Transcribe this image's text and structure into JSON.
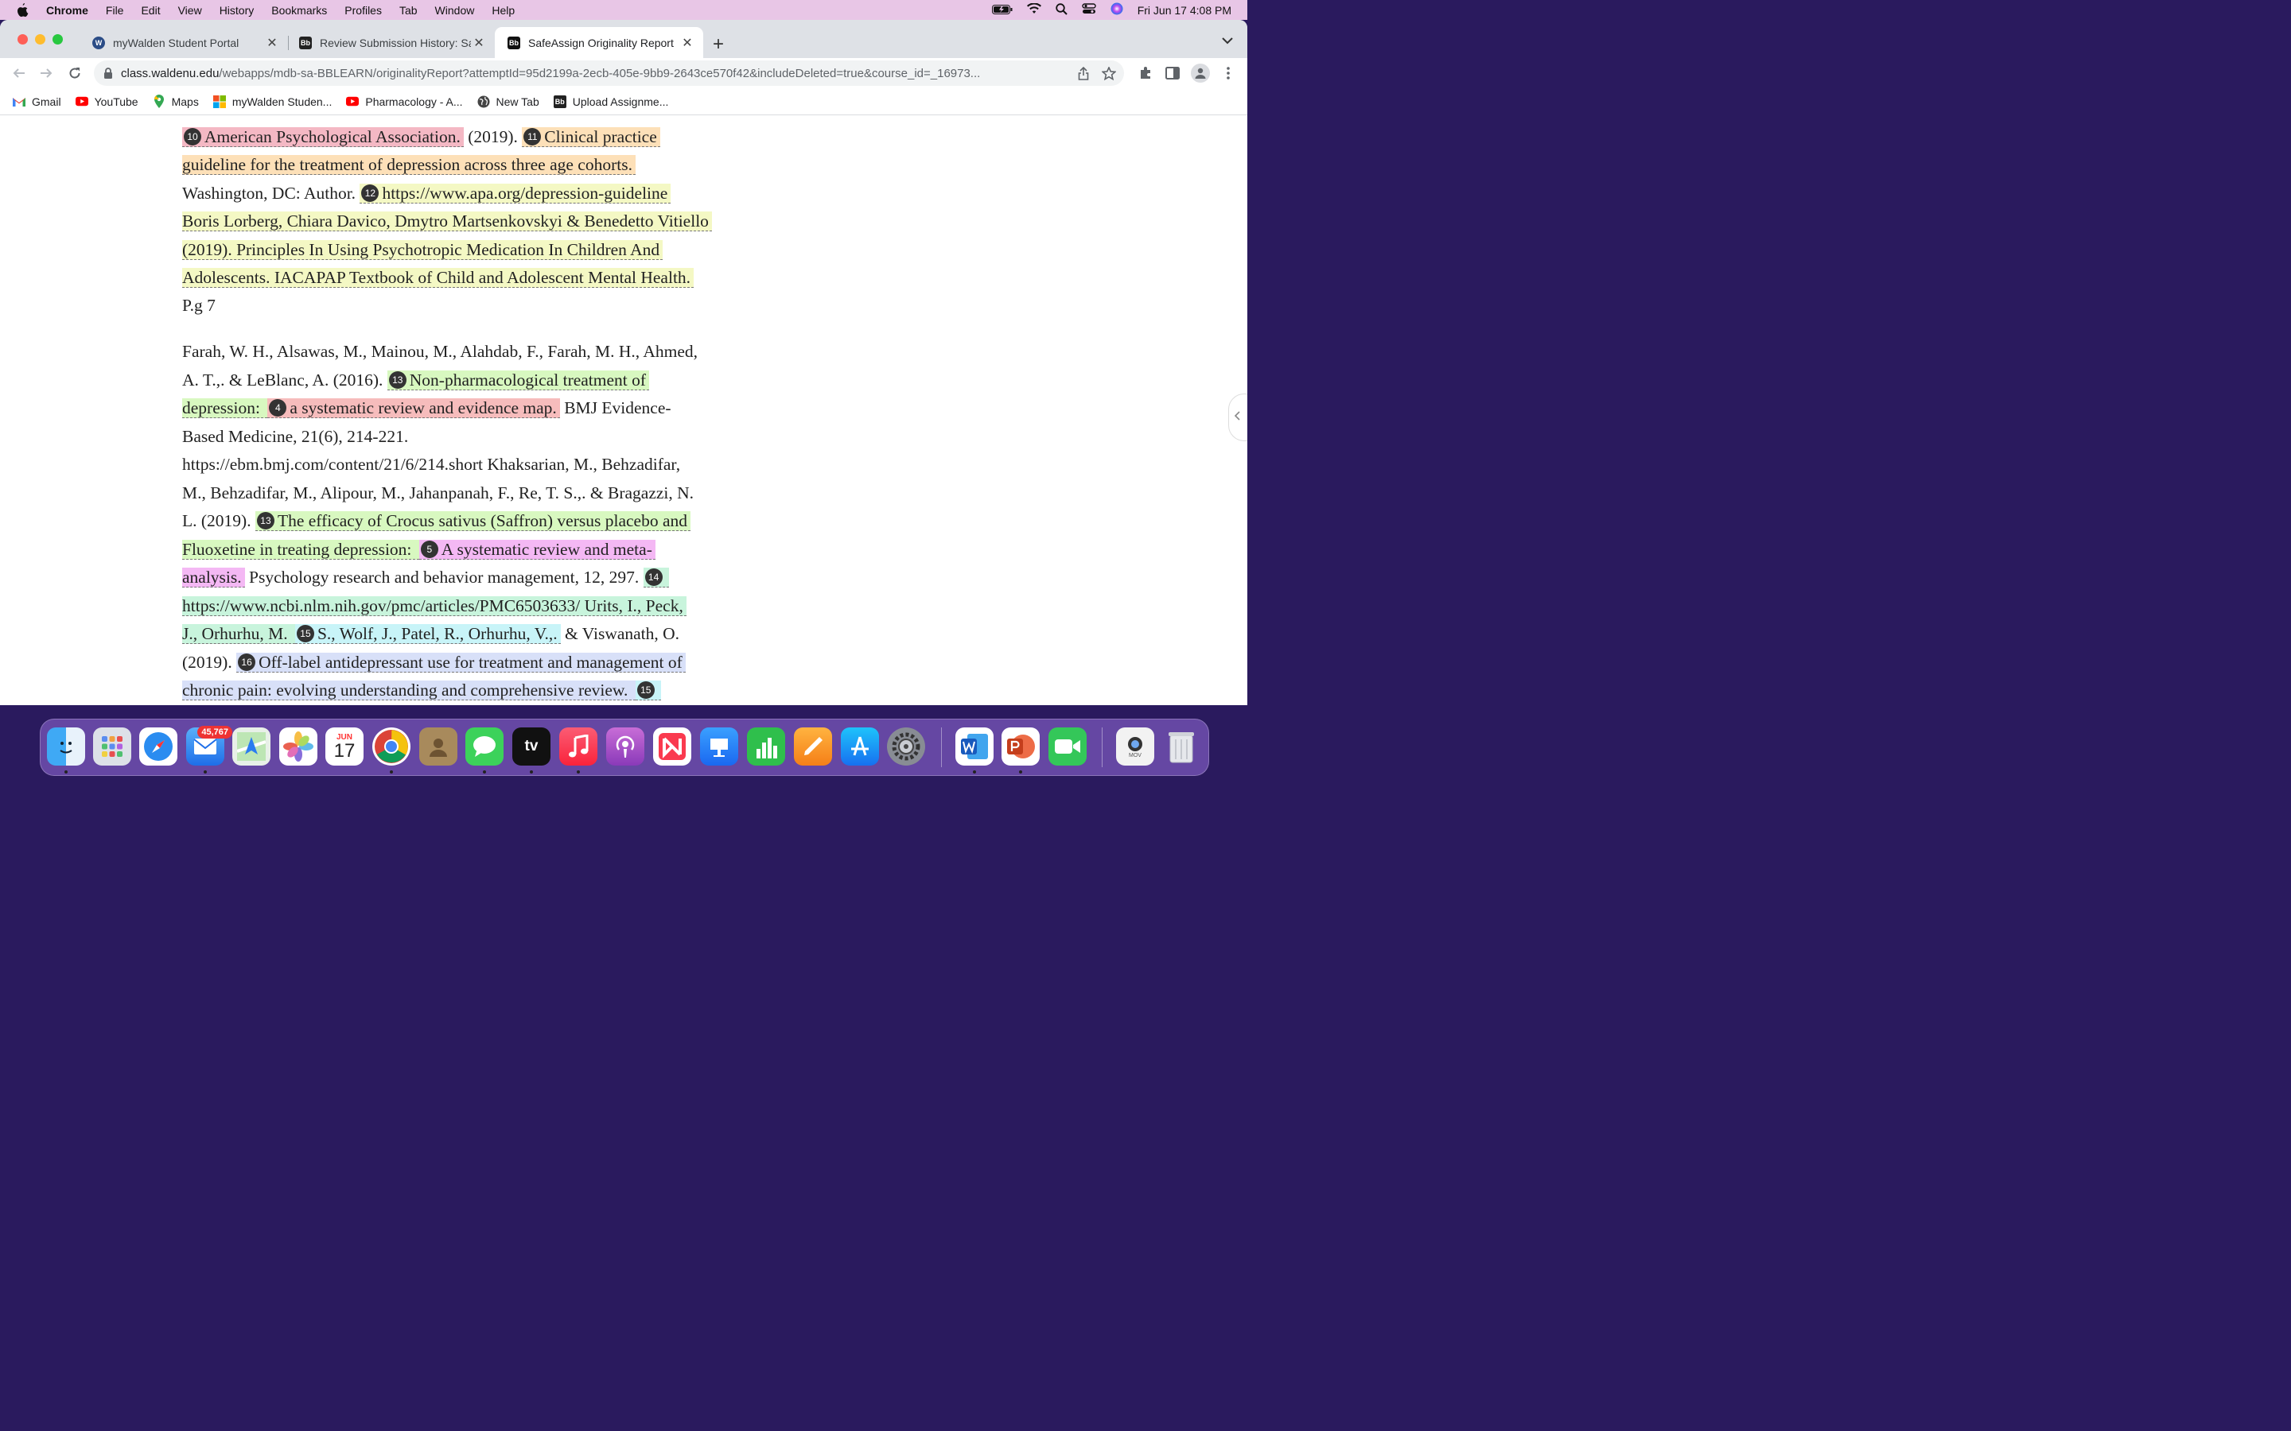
{
  "menubar": {
    "app": "Chrome",
    "items": [
      "File",
      "Edit",
      "View",
      "History",
      "Bookmarks",
      "Profiles",
      "Tab",
      "Window",
      "Help"
    ],
    "clock": "Fri Jun 17  4:08 PM"
  },
  "tabs": [
    {
      "label": "myWalden Student Portal",
      "icon": "wordpress-icon"
    },
    {
      "label": "Review Submission History: Sa",
      "icon": "blackboard-icon"
    },
    {
      "label": "SafeAssign Originality Report",
      "icon": "blackboard-icon"
    }
  ],
  "favicon_text": "Bb",
  "address": {
    "host": "class.waldenu.edu",
    "path": "/webapps/mdb-sa-BBLEARN/originalityReport?attemptId=95d2199a-2ecb-405e-9bb9-2643ce570f42&includeDeleted=true&course_id=_16973..."
  },
  "bookmarks": [
    {
      "label": "Gmail",
      "icon": "gmail-icon"
    },
    {
      "label": "YouTube",
      "icon": "youtube-icon"
    },
    {
      "label": "Maps",
      "icon": "maps-icon"
    },
    {
      "label": "myWalden Studen...",
      "icon": "microsoft-icon"
    },
    {
      "label": "Pharmacology - A...",
      "icon": "youtube-icon"
    },
    {
      "label": "New Tab",
      "icon": "globe-icon"
    },
    {
      "label": "Upload Assignme...",
      "icon": "blackboard-icon"
    }
  ],
  "report": {
    "l1": {
      "a": "American Psychological Association.",
      "b": " (2019). ",
      "c": "Clinical practice",
      "badge1": "10",
      "badge2": "11"
    },
    "l2": {
      "a": "guideline for the treatment of depression across three age cohorts."
    },
    "l3": {
      "a": "Washington, DC: Author. ",
      "badge": "12",
      "b": "https://www.apa.org/depression-guideline"
    },
    "l4": {
      "a": "Boris Lorberg, Chiara Davico, Dmytro Martsenkovskyi & Benedetto Vitiello"
    },
    "l5": {
      "a": "(2019).  Principles In Using Psychotropic Medication In Children And"
    },
    "l6": {
      "a": "Adolescents.  IACAPAP Textbook of Child and Adolescent Mental Health."
    },
    "l7": {
      "a": "P.g 7"
    },
    "l8": {
      "a": "Farah, W. H., Alsawas, M., Mainou, M., Alahdab, F., Farah, M. H., Ahmed,"
    },
    "l9": {
      "a": "A. T.,. & LeBlanc, A. (2016). ",
      "badge": "13",
      "b": "Non-pharmacological treatment of"
    },
    "l10": {
      "a": "depression: ",
      "badge": "4",
      "b": "a systematic review and evidence map.",
      "c": " BMJ Evidence-"
    },
    "l11": {
      "a": "Based Medicine, 21(6), 214-221."
    },
    "l12": {
      "a": "https://ebm.bmj.com/content/21/6/214.short Khaksarian, M., Behzadifar,"
    },
    "l13": {
      "a": "M., Behzadifar, M., Alipour, M., Jahanpanah, F., Re, T. S.,. & Bragazzi, N."
    },
    "l14": {
      "a": "L. (2019). ",
      "badge": "13",
      "b": "The efficacy of Crocus sativus (Saffron) versus placebo and"
    },
    "l15": {
      "a": "Fluoxetine in treating depression: ",
      "badge": "5",
      "b": "A systematic review and meta-"
    },
    "l16": {
      "a": "analysis.",
      "b": " Psychology research and behavior management, 12, 297. ",
      "badge": "14"
    },
    "l17": {
      "a": "https://www.ncbi.nlm.nih.gov/pmc/articles/PMC6503633/ Urits, I., Peck,"
    },
    "l18": {
      "a": "J., Orhurhu, M. ",
      "badge": "15",
      "b": "S., Wolf, J., Patel, R., Orhurhu, V.,.",
      "c": " & Viswanath, O."
    },
    "l19": {
      "a": "(2019). ",
      "badge": "16",
      "b": "Off-label antidepressant use for treatment and management of"
    },
    "l20": {
      "a": "chronic pain:  evolving understanding and comprehensive review. ",
      "badge": "15"
    }
  },
  "dock": {
    "mail_badge": "45,767",
    "calendar_month": "JUN",
    "calendar_day": "17",
    "tv_label": "tv",
    "file_label": "MOV"
  }
}
